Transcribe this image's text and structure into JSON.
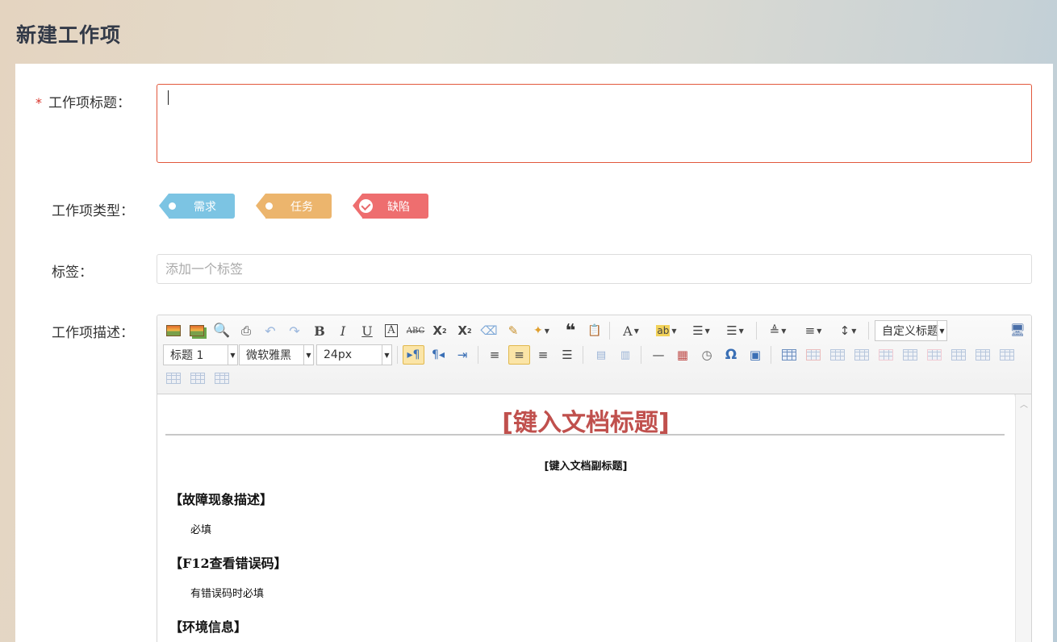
{
  "page": {
    "title": "新建工作项"
  },
  "form": {
    "title_field": {
      "required_mark": "*",
      "label": "工作项标题：",
      "value": ""
    },
    "type_field": {
      "label": "工作项类型：",
      "options": [
        {
          "label": "需求",
          "color": "#7cc4e3",
          "selected": false
        },
        {
          "label": "任务",
          "color": "#ecb56d",
          "selected": false
        },
        {
          "label": "缺陷",
          "color": "#ee6e6f",
          "selected": true
        }
      ]
    },
    "tag_field": {
      "label": "标签：",
      "placeholder": "添加一个标签"
    },
    "description_field": {
      "label": "工作项描述："
    }
  },
  "editor": {
    "toolbar": {
      "row1_icons": [
        "insert-image-icon",
        "image-gallery-icon",
        "preview-icon",
        "print-icon",
        "undo-icon",
        "redo-icon",
        "bold-icon",
        "italic-icon",
        "underline-icon",
        "font-border-icon",
        "strikethrough-icon",
        "superscript-icon",
        "subscript-icon",
        "eraser-icon",
        "format-brush-icon",
        "auto-format-icon",
        "blockquote-icon",
        "paste-text-icon",
        "font-color-icon",
        "highlight-color-icon",
        "ordered-list-icon",
        "unordered-list-icon",
        "row-spacing-top-icon",
        "row-spacing-bottom-icon",
        "line-height-icon",
        "fullscreen-icon"
      ],
      "custom_title_select": "自定义标题",
      "paragraph_select": "标题 1",
      "font_family_select": "微软雅黑",
      "font_size_select": "24px",
      "row2_icons": [
        "ltr-direction-icon",
        "rtl-direction-icon",
        "indent-icon",
        "align-left-icon",
        "align-center-icon",
        "align-right-icon",
        "align-justify-icon",
        "image-left-icon",
        "image-center-icon",
        "horizontal-rule-icon",
        "date-icon",
        "time-icon",
        "special-char-icon",
        "template-icon",
        "insert-table-icon",
        "delete-table-icon",
        "insert-paragraph-before-table-icon",
        "insert-row-icon",
        "delete-row-icon",
        "insert-col-icon",
        "delete-col-icon",
        "merge-cells-icon",
        "merge-right-icon",
        "merge-down-icon",
        "split-to-cells-icon",
        "split-to-rows-icon",
        "split-to-cols-icon"
      ]
    },
    "content": {
      "doc_title": "[键入文档标题]",
      "doc_subtitle": "[键入文档副标题]",
      "sections": [
        {
          "heading": "【故障现象描述】",
          "note": "必填"
        },
        {
          "heading": "【F12查看错误码】",
          "note": "有错误码时必填"
        },
        {
          "heading": "【环境信息】",
          "note": ""
        }
      ]
    }
  }
}
